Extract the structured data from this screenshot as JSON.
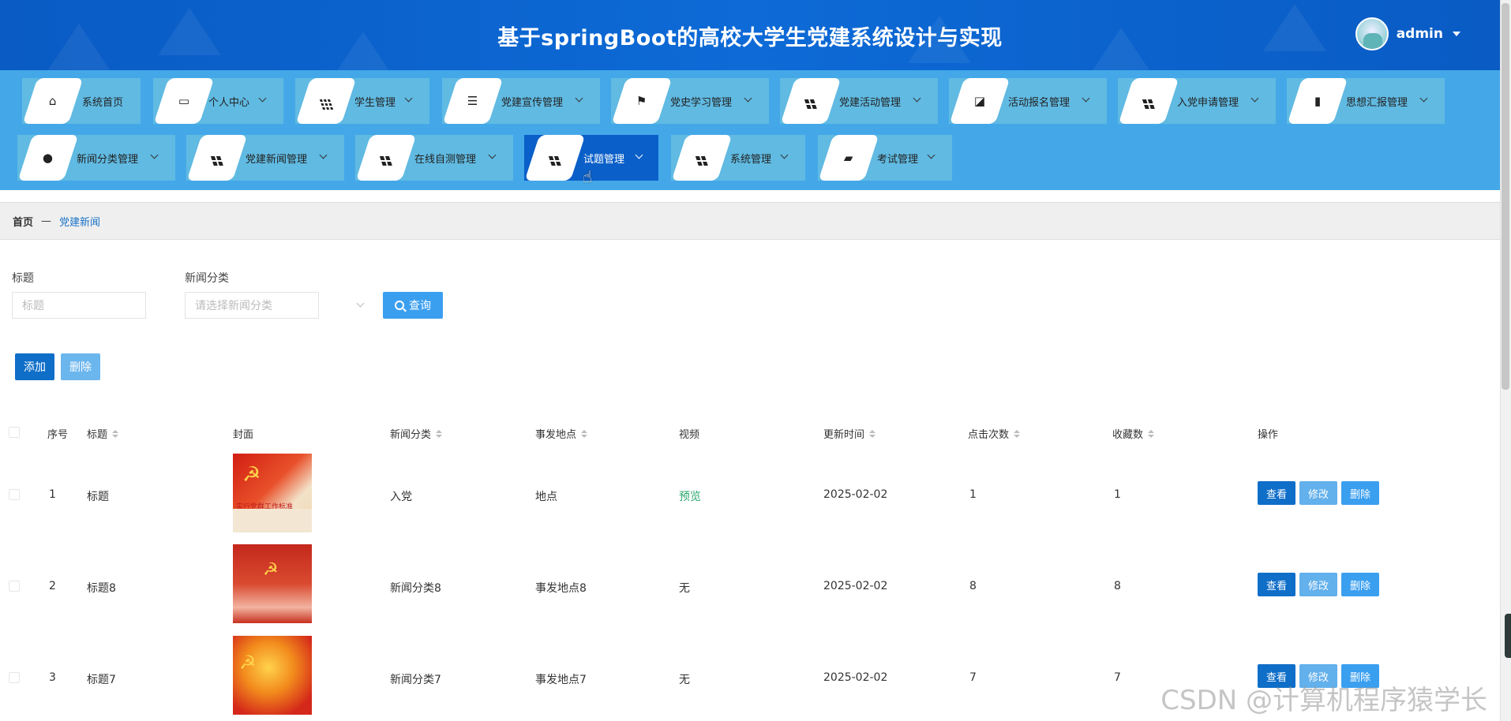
{
  "header": {
    "title": "基于springBoot的高校大学生党建系统设计与实现",
    "username": "admin"
  },
  "nav": {
    "items": [
      {
        "label": "系统首页",
        "icon": "home-icon",
        "has_dropdown": false
      },
      {
        "label": "个人中心",
        "icon": "wallet-icon",
        "has_dropdown": true
      },
      {
        "label": "学生管理",
        "icon": "grid-nine-icon",
        "has_dropdown": true
      },
      {
        "label": "党建宣传管理",
        "icon": "sliders-icon",
        "has_dropdown": true
      },
      {
        "label": "党史学习管理",
        "icon": "flag-icon",
        "has_dropdown": true
      },
      {
        "label": "党建活动管理",
        "icon": "grid-four-icon",
        "has_dropdown": true
      },
      {
        "label": "活动报名管理",
        "icon": "purse-icon",
        "has_dropdown": true
      },
      {
        "label": "入党申请管理",
        "icon": "grid-four-icon",
        "has_dropdown": true
      },
      {
        "label": "思想汇报管理",
        "icon": "bar-chart-icon",
        "has_dropdown": true
      },
      {
        "label": "新闻分类管理",
        "icon": "bulb-icon",
        "has_dropdown": true
      },
      {
        "label": "党建新闻管理",
        "icon": "grid-four-icon",
        "has_dropdown": true
      },
      {
        "label": "在线自测管理",
        "icon": "grid-four-icon",
        "has_dropdown": true
      },
      {
        "label": "试题管理",
        "icon": "grid-four-icon",
        "has_dropdown": true,
        "active": true
      },
      {
        "label": "系统管理",
        "icon": "grid-four-icon",
        "has_dropdown": true
      },
      {
        "label": "考试管理",
        "icon": "ticket-icon",
        "has_dropdown": true
      }
    ]
  },
  "breadcrumb": {
    "home": "首页",
    "separator": "—",
    "current": "党建新闻"
  },
  "search": {
    "title_label": "标题",
    "title_placeholder": "标题",
    "category_label": "新闻分类",
    "category_placeholder": "请选择新闻分类",
    "query_button": "查询"
  },
  "actions": {
    "add": "添加",
    "delete": "删除"
  },
  "table": {
    "headers": {
      "index": "序号",
      "title": "标题",
      "cover": "封面",
      "category": "新闻分类",
      "location": "事发地点",
      "video": "视频",
      "updated": "更新时间",
      "clicks": "点击次数",
      "favorites": "收藏数",
      "ops": "操作"
    },
    "rows": [
      {
        "index": "1",
        "title": "标题",
        "cover_text": "实行党群工作标准",
        "category": "入党",
        "location": "地点",
        "video": "预览",
        "updated": "2025-02-02",
        "clicks": "1",
        "favorites": "1"
      },
      {
        "index": "2",
        "title": "标题8",
        "cover_text": "",
        "category": "新闻分类8",
        "location": "事发地点8",
        "video": "无",
        "updated": "2025-02-02",
        "clicks": "8",
        "favorites": "8"
      },
      {
        "index": "3",
        "title": "标题7",
        "cover_text": "",
        "category": "新闻分类7",
        "location": "事发地点7",
        "video": "无",
        "updated": "2025-02-02",
        "clicks": "7",
        "favorites": "7"
      }
    ],
    "op_labels": {
      "view": "查看",
      "edit": "修改",
      "delete": "删除"
    }
  },
  "watermark": "CSDN @计算机程序猿学长",
  "colors": {
    "header": "#0a5bc4",
    "nav": "#44a8e8",
    "active_nav": "#0a5fc8",
    "primary": "#0f6ec8",
    "link": "#2aa86b"
  }
}
